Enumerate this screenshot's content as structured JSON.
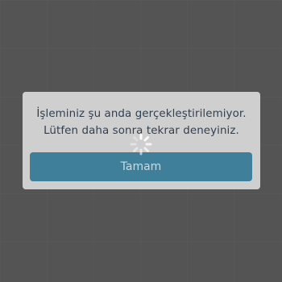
{
  "dialog": {
    "message_line1": "İşleminiz şu anda gerçekleştirilemiyor.",
    "message_line2": "Lütfen daha sonra tekrar deneyiniz.",
    "ok_label": "Tamam"
  },
  "colors": {
    "background": "#595959",
    "dialog": "#cfcfcf",
    "button": "#3f7f9a",
    "text": "#2f3f52"
  },
  "icons": {
    "loading": "loading-spinner-icon"
  }
}
